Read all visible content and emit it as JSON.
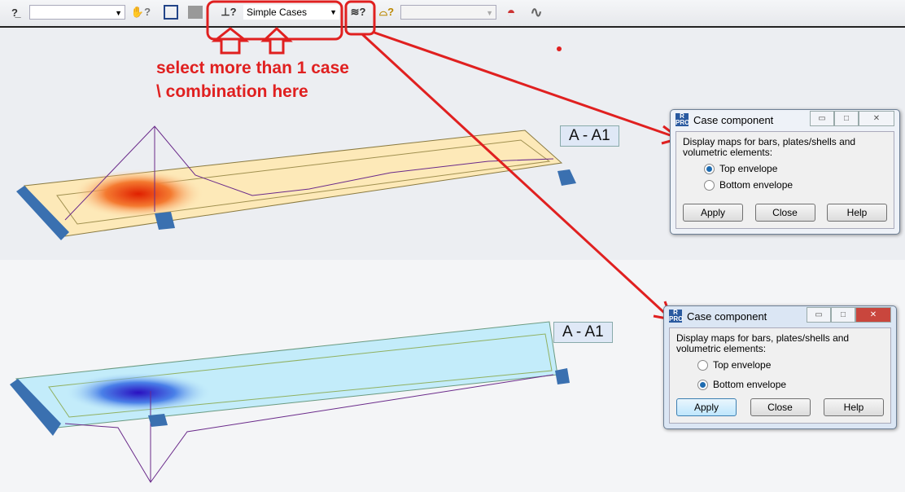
{
  "toolbar": {
    "combo1_value": "",
    "cases_combo_value": "Simple Cases",
    "combo3_value": "",
    "icons": [
      "load-help-icon",
      "hand-help-icon",
      "frame-icon",
      "grid-icon",
      "cases-icon",
      "envelope-icon",
      "component-icon",
      "map-icon",
      "wave-icon"
    ]
  },
  "view_top": {
    "section_label": "A - A1"
  },
  "view_bottom": {
    "section_label": "A - A1"
  },
  "dialog_top": {
    "title": "Case component",
    "logo": "R PRO",
    "description": "Display maps for bars, plates/shells and volumetric elements:",
    "options": [
      "Top envelope",
      "Bottom envelope"
    ],
    "selected": "Top envelope",
    "buttons": [
      "Apply",
      "Close",
      "Help"
    ]
  },
  "dialog_bottom": {
    "title": "Case component",
    "logo": "R PRO",
    "description": "Display maps for bars, plates/shells and volumetric elements:",
    "options": [
      "Top envelope",
      "Bottom envelope"
    ],
    "selected": "Bottom envelope",
    "buttons": [
      "Apply",
      "Close",
      "Help"
    ]
  },
  "annotation": {
    "line1": "select more than 1 case",
    "line2": "\\ combination here",
    "color": "#e02020"
  }
}
